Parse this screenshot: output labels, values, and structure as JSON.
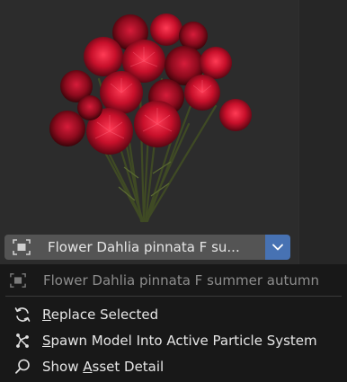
{
  "asset_browser": {
    "selector": {
      "label": "Flower Dahlia pinnata F su..."
    }
  },
  "context_menu": {
    "title": "Flower Dahlia pinnata F summer autumn",
    "items": [
      {
        "underline_char": "R",
        "rest": "eplace Selected",
        "icon": "refresh-icon"
      },
      {
        "underline_char": "S",
        "rest": "pawn Model Into Active Particle System",
        "icon": "particles-icon"
      },
      {
        "prefix": "Show ",
        "underline_char": "A",
        "rest": "sset Detail",
        "icon": "search-icon"
      }
    ]
  },
  "colors": {
    "accent": "#4772b3",
    "menu_bg": "#181818",
    "panel_bg": "#2c2c2c"
  }
}
